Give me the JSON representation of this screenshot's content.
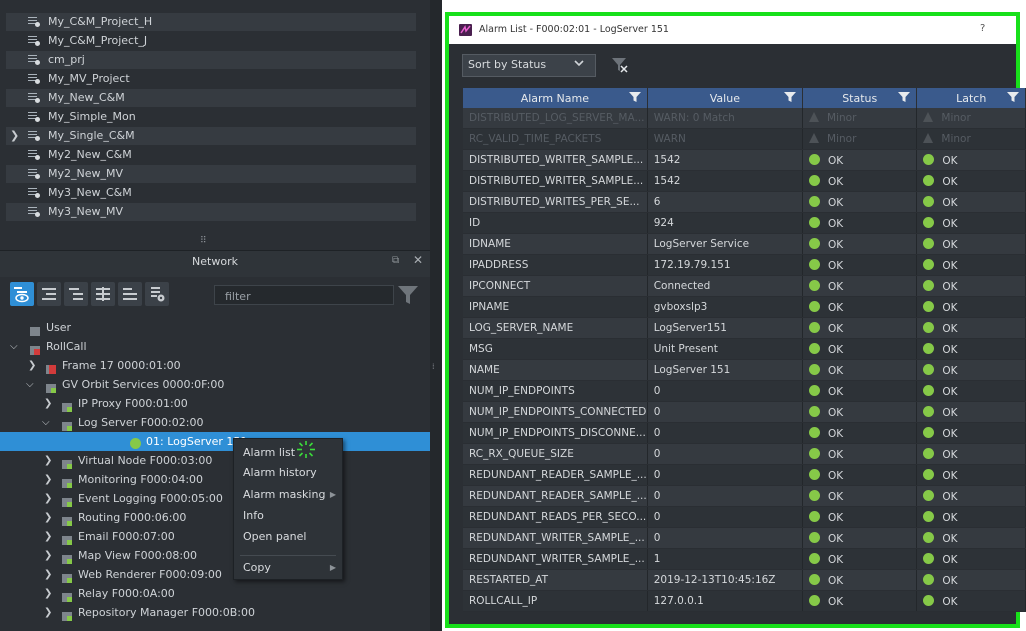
{
  "projects": [
    {
      "label": "My_C&M_Project_H",
      "expandable": false
    },
    {
      "label": "My_C&M_Project_J",
      "expandable": false
    },
    {
      "label": "cm_prj",
      "expandable": false
    },
    {
      "label": "My_MV_Project",
      "expandable": false
    },
    {
      "label": "My_New_C&M",
      "expandable": false
    },
    {
      "label": "My_Simple_Mon",
      "expandable": false
    },
    {
      "label": "My_Single_C&M",
      "expandable": true
    },
    {
      "label": "My2_New_C&M",
      "expandable": false
    },
    {
      "label": "My2_New_MV",
      "expandable": false
    },
    {
      "label": "My3_New_C&M",
      "expandable": false
    },
    {
      "label": "My3_New_MV",
      "expandable": false
    }
  ],
  "network": {
    "title": "Network",
    "filter_placeholder": "filter",
    "tree": [
      {
        "label": "User",
        "depth": 0,
        "chev": "",
        "icon": "folder-icon"
      },
      {
        "label": "RollCall",
        "depth": 0,
        "chev": "v",
        "icon": "rollcall-icon"
      },
      {
        "label": "Frame 17 0000:01:00",
        "depth": 1,
        "chev": ">",
        "icon": "frame-icon"
      },
      {
        "label": "GV Orbit Services 0000:0F:00",
        "depth": 1,
        "chev": "v",
        "icon": "service-icon"
      },
      {
        "label": "IP Proxy F000:01:00",
        "depth": 2,
        "chev": ">",
        "icon": "service-icon"
      },
      {
        "label": "Log Server F000:02:00",
        "depth": 2,
        "chev": "v",
        "icon": "service-icon"
      },
      {
        "label": "01: LogServer 151",
        "depth": 3,
        "chev": "",
        "icon": "status-ok-icon",
        "selected": true
      },
      {
        "label": "Virtual Node F000:03:00",
        "depth": 2,
        "chev": ">",
        "icon": "service-icon"
      },
      {
        "label": "Monitoring F000:04:00",
        "depth": 2,
        "chev": ">",
        "icon": "service-icon"
      },
      {
        "label": "Event Logging F000:05:00",
        "depth": 2,
        "chev": ">",
        "icon": "service-icon"
      },
      {
        "label": "Routing F000:06:00",
        "depth": 2,
        "chev": ">",
        "icon": "service-icon"
      },
      {
        "label": "Email F000:07:00",
        "depth": 2,
        "chev": ">",
        "icon": "service-icon"
      },
      {
        "label": "Map View F000:08:00",
        "depth": 2,
        "chev": ">",
        "icon": "service-icon"
      },
      {
        "label": "Web Renderer F000:09:00",
        "depth": 2,
        "chev": ">",
        "icon": "service-icon"
      },
      {
        "label": "Relay F000:0A:00",
        "depth": 2,
        "chev": ">",
        "icon": "service-icon"
      },
      {
        "label": "Repository Manager F000:0B:00",
        "depth": 2,
        "chev": ">",
        "icon": "service-icon"
      }
    ]
  },
  "context_menu": {
    "items": [
      {
        "label": "Alarm list",
        "submenu": false
      },
      {
        "label": "Alarm history",
        "submenu": false
      },
      {
        "label": "Alarm masking",
        "submenu": true
      },
      {
        "label": "Info",
        "submenu": false
      },
      {
        "label": "Open panel",
        "submenu": false
      },
      {
        "label": "Copy",
        "submenu": true
      }
    ]
  },
  "alarm_window": {
    "title": "Alarm List - F000:02:01 - LogServer 151",
    "help": "?",
    "sort_label": "Sort by Status",
    "columns": [
      "Alarm Name",
      "Value",
      "Status",
      "Latch"
    ],
    "rows": [
      {
        "name": "DISTRIBUTED_LOG_SERVER_MA...",
        "value": "WARN: 0 Match",
        "status": "Minor",
        "latch": "Minor",
        "dim": true
      },
      {
        "name": "RC_VALID_TIME_PACKETS",
        "value": "WARN",
        "status": "Minor",
        "latch": "Minor",
        "dim": true
      },
      {
        "name": "DISTRIBUTED_WRITER_SAMPLE...",
        "value": "1542",
        "status": "OK",
        "latch": "OK"
      },
      {
        "name": "DISTRIBUTED_WRITER_SAMPLE...",
        "value": "1542",
        "status": "OK",
        "latch": "OK"
      },
      {
        "name": "DISTRIBUTED_WRITES_PER_SE...",
        "value": "6",
        "status": "OK",
        "latch": "OK"
      },
      {
        "name": "ID",
        "value": "924",
        "status": "OK",
        "latch": "OK"
      },
      {
        "name": "IDNAME",
        "value": "LogServer Service",
        "status": "OK",
        "latch": "OK"
      },
      {
        "name": "IPADDRESS",
        "value": "172.19.79.151",
        "status": "OK",
        "latch": "OK"
      },
      {
        "name": "IPCONNECT",
        "value": "Connected",
        "status": "OK",
        "latch": "OK"
      },
      {
        "name": "IPNAME",
        "value": "gvboxslp3",
        "status": "OK",
        "latch": "OK"
      },
      {
        "name": "LOG_SERVER_NAME",
        "value": "LogServer151",
        "status": "OK",
        "latch": "OK"
      },
      {
        "name": "MSG",
        "value": "Unit Present",
        "status": "OK",
        "latch": "OK"
      },
      {
        "name": "NAME",
        "value": "LogServer 151",
        "status": "OK",
        "latch": "OK"
      },
      {
        "name": "NUM_IP_ENDPOINTS",
        "value": "0",
        "status": "OK",
        "latch": "OK"
      },
      {
        "name": "NUM_IP_ENDPOINTS_CONNECTED",
        "value": "0",
        "status": "OK",
        "latch": "OK"
      },
      {
        "name": "NUM_IP_ENDPOINTS_DISCONNE...",
        "value": "0",
        "status": "OK",
        "latch": "OK"
      },
      {
        "name": "RC_RX_QUEUE_SIZE",
        "value": "0",
        "status": "OK",
        "latch": "OK"
      },
      {
        "name": "REDUNDANT_READER_SAMPLE_...",
        "value": "0",
        "status": "OK",
        "latch": "OK"
      },
      {
        "name": "REDUNDANT_READER_SAMPLE_...",
        "value": "0",
        "status": "OK",
        "latch": "OK"
      },
      {
        "name": "REDUNDANT_READS_PER_SECO...",
        "value": "0",
        "status": "OK",
        "latch": "OK"
      },
      {
        "name": "REDUNDANT_WRITER_SAMPLE_...",
        "value": "0",
        "status": "OK",
        "latch": "OK"
      },
      {
        "name": "REDUNDANT_WRITER_SAMPLE_...",
        "value": "1",
        "status": "OK",
        "latch": "OK"
      },
      {
        "name": "RESTARTED_AT",
        "value": "2019-12-13T10:45:16Z",
        "status": "OK",
        "latch": "OK"
      },
      {
        "name": "ROLLCALL_IP",
        "value": "127.0.0.1",
        "status": "OK",
        "latch": "OK"
      }
    ]
  },
  "colors": {
    "highlight": "#18e01a",
    "accent": "#2f8fd6",
    "ok": "#86c948",
    "header": "#3a5a8c"
  }
}
